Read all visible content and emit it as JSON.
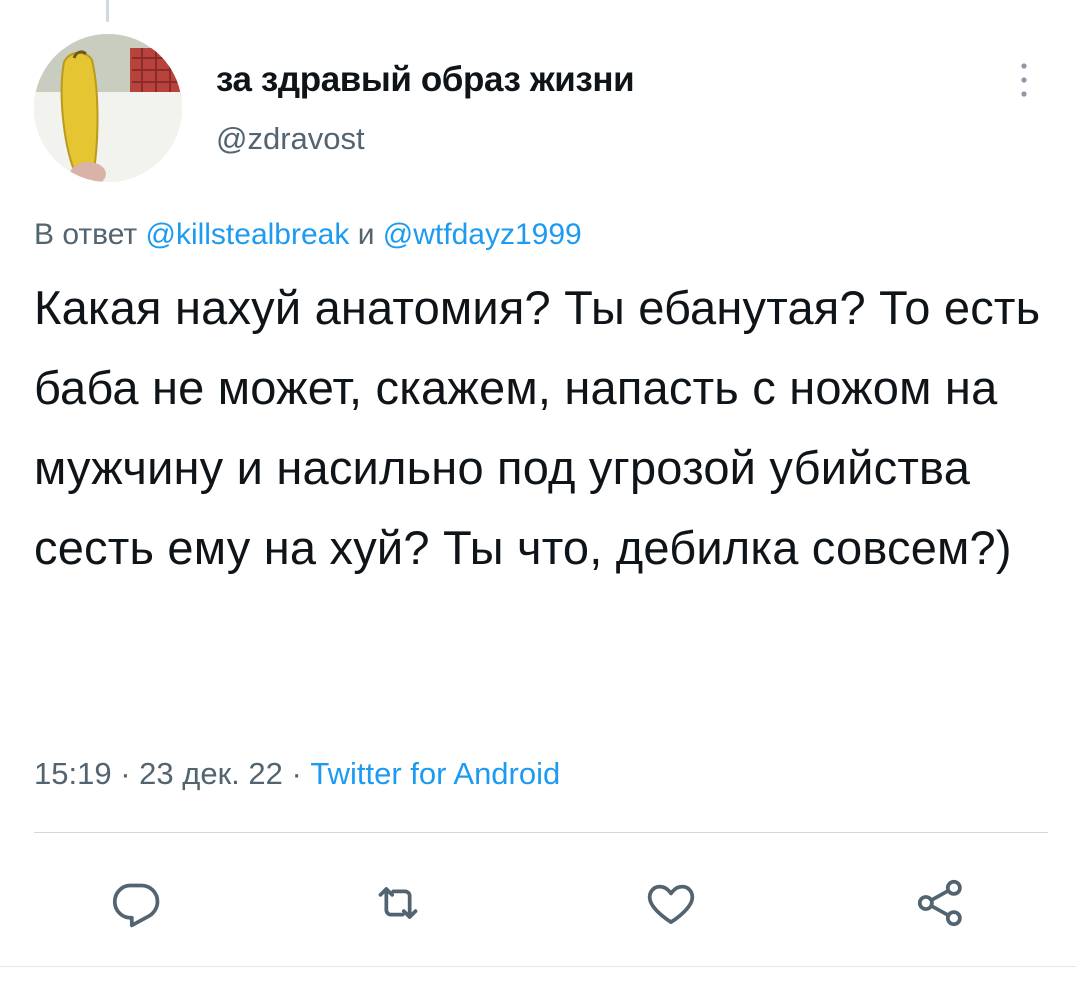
{
  "tweet": {
    "author_name": "за здравый образ жизни",
    "author_handle": "@zdravost",
    "reply_prefix": "В ответ ",
    "reply_user_1": "@killstealbreak",
    "reply_joiner": " и ",
    "reply_user_2": "@wtfdayz1999",
    "text": "Какая нахуй анатомия? Ты ебанутая? То есть баба не может, скажем, напасть с ножом на мужчину и насильно под угрозой убийства сесть ему на хуй? Ты что, дебилка совсем?)",
    "time": "15:19",
    "separator": " · ",
    "date": "23 дек. 22",
    "source": "Twitter for Android"
  },
  "icons": {
    "more": "more-vertical-icon",
    "reply": "reply-bubble-icon",
    "retweet": "retweet-icon",
    "like": "heart-icon",
    "share": "share-icon"
  },
  "colors": {
    "link": "#1d9bf0",
    "secondary_text": "#536471",
    "primary_text": "#0f1419",
    "divider": "#cfd9de"
  }
}
